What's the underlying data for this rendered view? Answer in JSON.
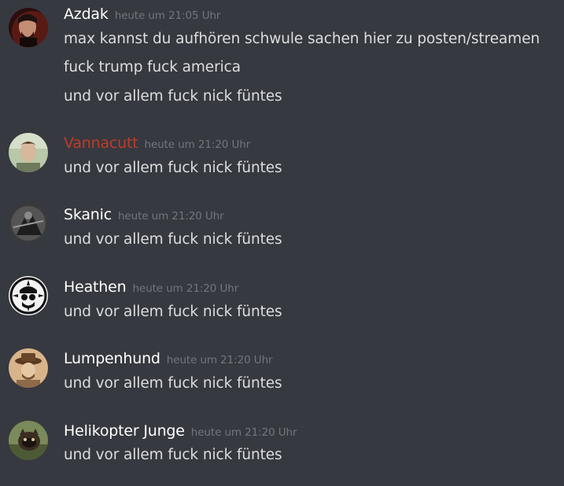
{
  "messages": [
    {
      "username": "Azdak",
      "timestamp": "heute um 21:05 Uhr",
      "lines": [
        "max kannst du aufhören schwule sachen hier zu posten/streamen",
        "fuck trump fuck america",
        "und vor allem fuck nick füntes"
      ]
    },
    {
      "username": "Vannacutt",
      "username_color": "#c23a2b",
      "timestamp": "heute um 21:20 Uhr",
      "lines": [
        "und vor allem fuck nick füntes"
      ]
    },
    {
      "username": "Skanic",
      "timestamp": "heute um 21:20 Uhr",
      "lines": [
        "und vor allem fuck nick füntes"
      ]
    },
    {
      "username": "Heathen",
      "timestamp": "heute um 21:20 Uhr",
      "lines": [
        "und vor allem fuck nick füntes"
      ]
    },
    {
      "username": "Lumpenhund",
      "timestamp": "heute um 21:20 Uhr",
      "lines": [
        "und vor allem fuck nick füntes"
      ]
    },
    {
      "username": "Helikopter Junge",
      "timestamp": "heute um 21:20 Uhr",
      "lines": [
        "und vor allem fuck nick füntes"
      ]
    }
  ],
  "colors": {
    "background": "#36393f",
    "text": "#dcddde",
    "username": "#ffffff",
    "timestamp": "#72767d"
  }
}
